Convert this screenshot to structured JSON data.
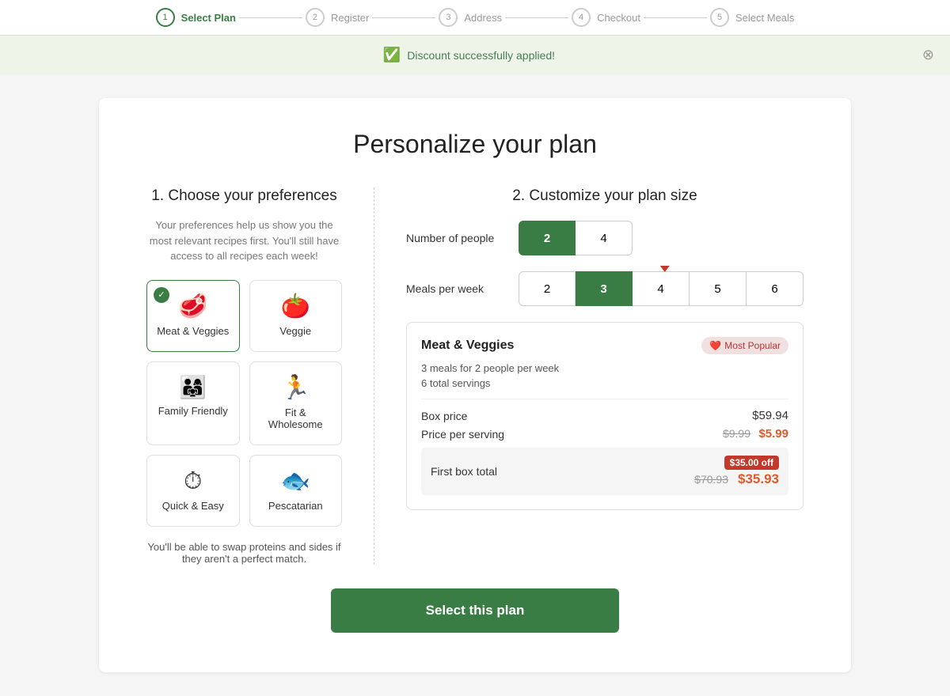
{
  "header": {
    "steps": [
      {
        "number": "1",
        "label": "Select Plan",
        "active": true
      },
      {
        "number": "2",
        "label": "Register",
        "active": false
      },
      {
        "number": "3",
        "label": "Address",
        "active": false
      },
      {
        "number": "4",
        "label": "Checkout",
        "active": false
      },
      {
        "number": "5",
        "label": "Select Meals",
        "active": false
      }
    ]
  },
  "banner": {
    "message": "Discount successfully applied!",
    "close_label": "✕"
  },
  "page": {
    "title": "Personalize your plan",
    "section1_title": "1. Choose your preferences",
    "section1_hint": "Your preferences help us show you the most relevant recipes first. You'll still have access to all recipes each week!",
    "preferences": [
      {
        "id": "meat-veggies",
        "label": "Meat & Veggies",
        "icon": "🥩",
        "selected": true
      },
      {
        "id": "veggie",
        "label": "Veggie",
        "icon": "🍅",
        "selected": false
      },
      {
        "id": "family-friendly",
        "label": "Family Friendly",
        "icon": "👨‍👩‍👧",
        "selected": false
      },
      {
        "id": "fit-wholesome",
        "label": "Fit & Wholesome",
        "icon": "🏃",
        "selected": false
      },
      {
        "id": "quick-easy",
        "label": "Quick & Easy",
        "icon": "⏱",
        "selected": false
      },
      {
        "id": "pescatarian",
        "label": "Pescatarian",
        "icon": "🐟",
        "selected": false
      }
    ],
    "swap_note": "You'll be able to swap proteins and sides if they aren't a perfect match.",
    "section2_title": "2. Customize your plan size",
    "number_of_people_label": "Number of people",
    "people_options": [
      "2",
      "4"
    ],
    "people_selected": "2",
    "meals_per_week_label": "Meals per week",
    "meals_options": [
      "2",
      "3",
      "4",
      "5",
      "6"
    ],
    "meals_selected": "3",
    "summary": {
      "plan_name": "Meat & Veggies",
      "most_popular_label": "Most Popular",
      "meals_description": "3 meals for 2 people per week",
      "total_servings": "6 total servings",
      "box_price_label": "Box price",
      "box_price_value": "$59.94",
      "price_per_serving_label": "Price per serving",
      "price_per_serving_original": "$9.99",
      "price_per_serving_discounted": "$5.99",
      "first_box_label": "First box total",
      "off_badge": "$35.00 off",
      "first_box_original": "$70.93",
      "first_box_discounted": "$35.93"
    },
    "select_button_label": "Select this plan"
  }
}
